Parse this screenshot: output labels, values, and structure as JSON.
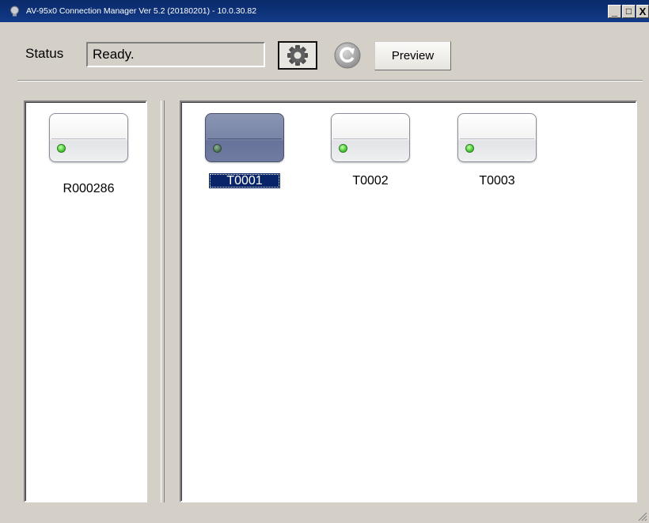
{
  "window": {
    "title": "AV-95x0 Connection Manager Ver 5.2 (20180201) - 10.0.30.82",
    "minimize_label": "_",
    "maximize_label": "□",
    "close_label": "X"
  },
  "toolbar": {
    "status_label": "Status",
    "status_value": "Ready.",
    "settings_icon": "gear-icon",
    "refresh_icon": "refresh-icon",
    "preview_label": "Preview"
  },
  "receivers": [
    {
      "name": "R000286",
      "online": true
    }
  ],
  "transmitters": [
    {
      "name": "T0001",
      "selected": true,
      "online": true
    },
    {
      "name": "T0002",
      "selected": false,
      "online": true
    },
    {
      "name": "T0003",
      "selected": false,
      "online": true
    }
  ],
  "colors": {
    "selection": "#0a246a",
    "led_green": "#4fd23a",
    "window_bg": "#d4d0c8"
  }
}
